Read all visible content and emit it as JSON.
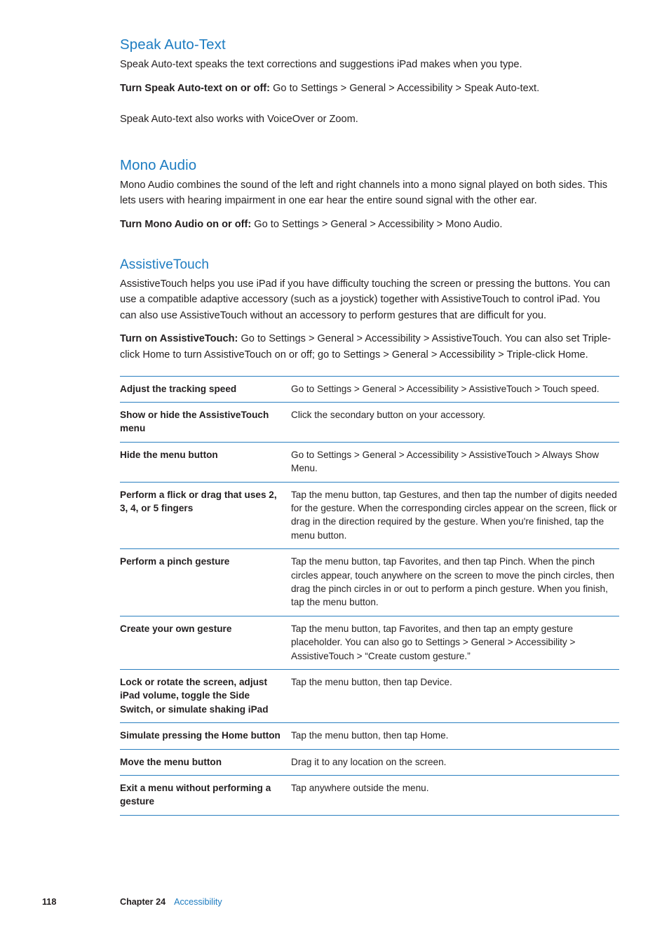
{
  "sections": [
    {
      "title": "Speak Auto-Text",
      "paragraphs": [
        {
          "text": "Speak Auto-text speaks the text corrections and suggestions iPad makes when you type."
        },
        {
          "bold": "Turn Speak Auto-text on or off:",
          "text": " Go to Settings > General > Accessibility > Speak Auto-text."
        },
        {
          "text": "Speak Auto-text also works with VoiceOver or Zoom."
        }
      ]
    },
    {
      "title": "Mono Audio",
      "paragraphs": [
        {
          "text": "Mono Audio combines the sound of the left and right channels into a mono signal played on both sides. This lets users with hearing impairment in one ear hear the entire sound signal with the other ear."
        },
        {
          "bold": "Turn Mono Audio on or off:",
          "text": "  Go to Settings > General > Accessibility > Mono Audio."
        }
      ]
    },
    {
      "title": "AssistiveTouch",
      "paragraphs": [
        {
          "text": "AssistiveTouch helps you use iPad if you have difficulty touching the screen or pressing the buttons. You can use a compatible adaptive accessory (such as a joystick) together with AssistiveTouch to control iPad. You can also use AssistiveTouch without an accessory to perform gestures that are difficult for you."
        },
        {
          "bold": "Turn on AssistiveTouch:",
          "text": " Go to Settings > General > Accessibility > AssistiveTouch. You can also set Triple-click Home to turn AssistiveTouch on or off; go to Settings > General > Accessibility > Triple-click Home."
        }
      ]
    }
  ],
  "table": {
    "rows": [
      {
        "label": "Adjust the tracking speed",
        "desc": "Go to Settings > General > Accessibility > AssistiveTouch > Touch speed."
      },
      {
        "label": "Show or hide the AssistiveTouch menu",
        "desc": "Click the secondary button on your accessory."
      },
      {
        "label": "Hide the menu button",
        "desc": "Go to Settings > General > Accessibility > AssistiveTouch > Always Show Menu."
      },
      {
        "label": "Perform a flick or drag that uses 2, 3, 4, or 5 fingers",
        "desc": "Tap the menu button, tap Gestures, and then tap the number of digits needed for the gesture. When the corresponding circles appear on the screen, flick or drag in the direction required by the gesture. When you're finished, tap the menu button."
      },
      {
        "label": "Perform a pinch gesture",
        "desc": "Tap the menu button, tap Favorites, and then tap Pinch. When the pinch circles appear, touch anywhere on the screen to move the pinch circles, then drag the pinch circles in or out to perform a pinch gesture. When you finish, tap the menu button."
      },
      {
        "label": "Create your own gesture",
        "desc": "Tap the menu button, tap Favorites, and then tap an empty gesture placeholder. You can also go to Settings > General > Accessibility > AssistiveTouch > “Create custom gesture.”"
      },
      {
        "label": "Lock or rotate the screen, adjust iPad volume, toggle the Side Switch, or simulate shaking iPad",
        "desc": "Tap the menu button, then tap Device."
      },
      {
        "label": "Simulate pressing the Home button",
        "desc": "Tap the menu button, then tap Home."
      },
      {
        "label": "Move the menu button",
        "desc": "Drag it to any location on the screen."
      },
      {
        "label": "Exit a menu without performing a gesture",
        "desc": "Tap anywhere outside the menu."
      }
    ]
  },
  "footer": {
    "page_number": "118",
    "chapter": "Chapter 24",
    "chapter_link": "Accessibility"
  },
  "colors": {
    "heading": "#1d7cc1",
    "rule": "#2a7fc0",
    "body": "#231f20"
  }
}
